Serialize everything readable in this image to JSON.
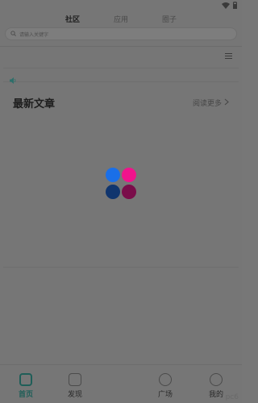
{
  "status_bar": {
    "icons": [
      "wifi-icon",
      "battery-icon"
    ]
  },
  "top_tabs": [
    {
      "label": "社区",
      "active": true
    },
    {
      "label": "应用",
      "active": false
    },
    {
      "label": "圈子",
      "active": false
    }
  ],
  "search": {
    "placeholder": "请输入关键字"
  },
  "section": {
    "title": "最新文章",
    "read_more": "阅读更多"
  },
  "bottom_nav": [
    {
      "label": "首页",
      "icon": "home-icon",
      "active": true
    },
    {
      "label": "发现",
      "icon": "discover-icon",
      "active": false
    },
    {
      "label": "广场",
      "icon": "square-icon",
      "active": false
    },
    {
      "label": "我的",
      "icon": "profile-icon",
      "active": false
    }
  ],
  "watermark": "pc6",
  "colors": {
    "overlay": "#767676",
    "accent": "#2d6f6a",
    "loader": [
      "#1a6fe8",
      "#f0138c",
      "#10356e",
      "#7a0d4a"
    ]
  }
}
